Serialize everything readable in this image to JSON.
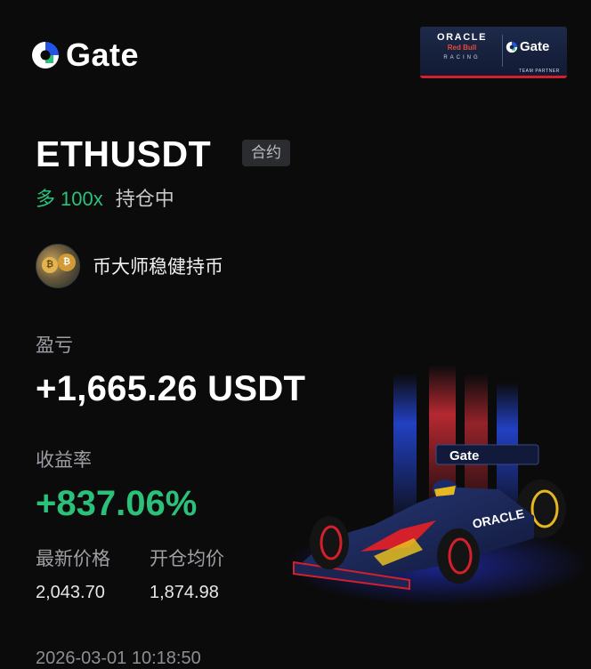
{
  "header": {
    "brand_name": "Gate",
    "sponsor": {
      "line1": "ORACLE",
      "line2": "Red Bull",
      "line3": "RACING",
      "brand": "Gate",
      "partner": "TEAM PARTNER"
    }
  },
  "position": {
    "symbol": "ETHUSDT",
    "contract_tag": "合约",
    "side": "多",
    "leverage": "100x",
    "status": "持仓中"
  },
  "author": {
    "name": "币大师稳健持币"
  },
  "pnl": {
    "label": "盈亏",
    "value": "+1,665.26 USDT"
  },
  "roi": {
    "label": "收益率",
    "value": "+837.06%"
  },
  "prices": {
    "latest_label": "最新价格",
    "latest_value": "2,043.70",
    "entry_label": "开仓均价",
    "entry_value": "1,874.98"
  },
  "timestamp": "2026-03-01 10:18:50",
  "car": {
    "wing_text": "Gate",
    "side_text": "ORACLE"
  },
  "colors": {
    "background": "#0b0b0c",
    "profit_green": "#2cc17a",
    "brand_blue": "#2354e6",
    "muted_text": "#9d9fa4"
  }
}
